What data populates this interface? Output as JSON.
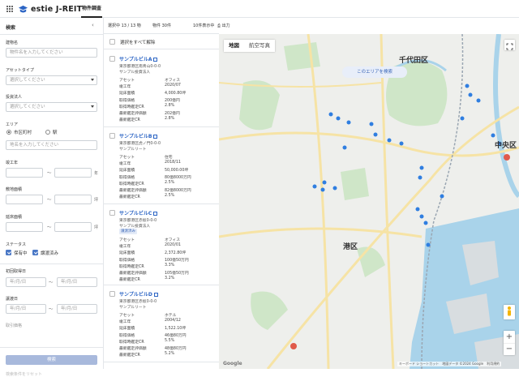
{
  "app": {
    "brand": "estie J-REIT",
    "active_tab": "物件調査"
  },
  "sidebar": {
    "title": "検索",
    "building_name": {
      "label": "建物名",
      "placeholder": "物件名を入力してください"
    },
    "asset_type": {
      "label": "アセットタイプ",
      "placeholder": "選択してください"
    },
    "investment_corp": {
      "label": "投資法人",
      "placeholder": "選択してください"
    },
    "area": {
      "label": "エリア",
      "options": [
        "市区町村",
        "駅"
      ],
      "selected": "市区町村",
      "placeholder": "地名を入力してください"
    },
    "built_year": {
      "label": "竣工年",
      "unit": "年"
    },
    "site_area": {
      "label": "敷地面積",
      "unit": "坪"
    },
    "floor_area": {
      "label": "延床面積",
      "unit": "坪"
    },
    "status": {
      "label": "ステータス",
      "options": [
        {
          "label": "保有中",
          "checked": true
        },
        {
          "label": "譲渡済み",
          "checked": true
        }
      ]
    },
    "first_acq": {
      "label": "初回取得日",
      "placeholder": "年/月/日"
    },
    "transfer_date": {
      "label": "譲渡日",
      "placeholder": "年/月/日"
    },
    "truncated_label": "取引価格",
    "search_button": "検索",
    "reset": "検索条件をリセット"
  },
  "results": {
    "selected": "選択中 13 / 13 物",
    "count": "物件 30件",
    "map_count": "10件表示中",
    "print": "出力",
    "select_all": "選択をすべて解除",
    "cards": [
      {
        "name": "サンプルビルA",
        "addr": "東京都港区南青山0-0-0",
        "type": "サンプル投資法人",
        "badge": "",
        "rows": [
          [
            "アセット",
            "オフィス"
          ],
          [
            "竣工年",
            "2020/07"
          ],
          [
            "延床面積",
            "4,000.80坪"
          ],
          [
            "取得価格",
            "200億円"
          ],
          [
            "取得時鑑定CR",
            "2.8%"
          ],
          [
            "最新鑑定評価額",
            "202億円"
          ],
          [
            "最新鑑定CR",
            "2.8%"
          ]
        ]
      },
      {
        "name": "サンプルビルB",
        "addr": "東京都港区虎ノ門0-0-0",
        "type": "サンプルリート",
        "badge": "",
        "rows": [
          [
            "アセット",
            "住宅"
          ],
          [
            "竣工年",
            "2018/11"
          ],
          [
            "延床面積",
            "50,000.00坪"
          ],
          [
            "取得価格",
            "80億8000万円"
          ],
          [
            "取得時鑑定CR",
            "2.5%"
          ],
          [
            "最新鑑定評価額",
            "82億8000万円"
          ],
          [
            "最新鑑定CR",
            "2.5%"
          ]
        ]
      },
      {
        "name": "サンプルビルC",
        "addr": "東京都港区赤坂0-0-0",
        "type": "サンプル投資法人",
        "badge": "譲渡済み",
        "rows": [
          [
            "アセット",
            "オフィス"
          ],
          [
            "竣工年",
            "2020/01"
          ],
          [
            "延床面積",
            "2,372.80坪"
          ],
          [
            "取得価格",
            "100億50万円"
          ],
          [
            "取得時鑑定CR",
            "3.3%"
          ],
          [
            "最新鑑定評価額",
            "105億50万円"
          ],
          [
            "最新鑑定CR",
            "3.2%"
          ]
        ]
      },
      {
        "name": "サンプルビルD",
        "addr": "東京都港区赤坂0-0-0",
        "type": "サンプルリート",
        "badge": "",
        "rows": [
          [
            "アセット",
            "ホテル"
          ],
          [
            "竣工年",
            "2004/12"
          ],
          [
            "延床面積",
            "1,522.10坪"
          ],
          [
            "取得価格",
            "46億80万円"
          ],
          [
            "取得時鑑定CR",
            "5.5%"
          ],
          [
            "最新鑑定評価額",
            "48億80万円"
          ],
          [
            "最新鑑定CR",
            "5.2%"
          ]
        ]
      }
    ]
  },
  "map": {
    "types": [
      "地図",
      "航空写真"
    ],
    "active_type": "地図",
    "cta": "このエリアを検索",
    "labels": {
      "chiyoda": "千代田区",
      "chuo": "中央区",
      "minato": "港区"
    },
    "footer": "キーボード ショートカット　地図データ ©2024 Google　利用規約",
    "google": "Google"
  },
  "colors": {
    "accent": "#2b64c4",
    "marker": "#2f7ee0",
    "water": "#a9d3ea",
    "park": "#cfe6c8",
    "road_major": "#f6e3a5"
  }
}
